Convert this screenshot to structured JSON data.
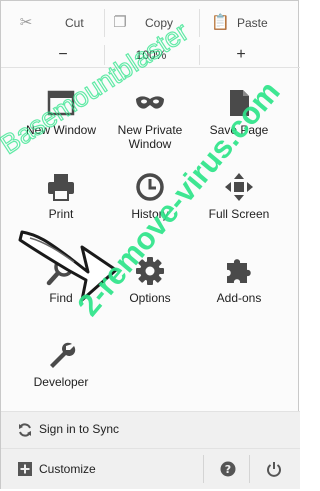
{
  "edit": {
    "cut": "Cut",
    "copy": "Copy",
    "paste": "Paste"
  },
  "zoom": {
    "minus": "−",
    "value": "100%",
    "plus": "+"
  },
  "tiles": {
    "new_window": "New Window",
    "new_private_window": "New Private Window",
    "save_page": "Save Page",
    "print": "Print",
    "history": "History",
    "full_screen": "Full Screen",
    "find": "Find",
    "options": "Options",
    "addons": "Add-ons",
    "developer": "Developer"
  },
  "footer": {
    "sign_in": "Sign in to Sync",
    "customize": "Customize"
  },
  "watermark": {
    "line1": "2-remove-virus.com",
    "line2": "Basemountblaster"
  },
  "colors": {
    "watermark": "#2ee58a",
    "icon": "#4a4a4a"
  }
}
